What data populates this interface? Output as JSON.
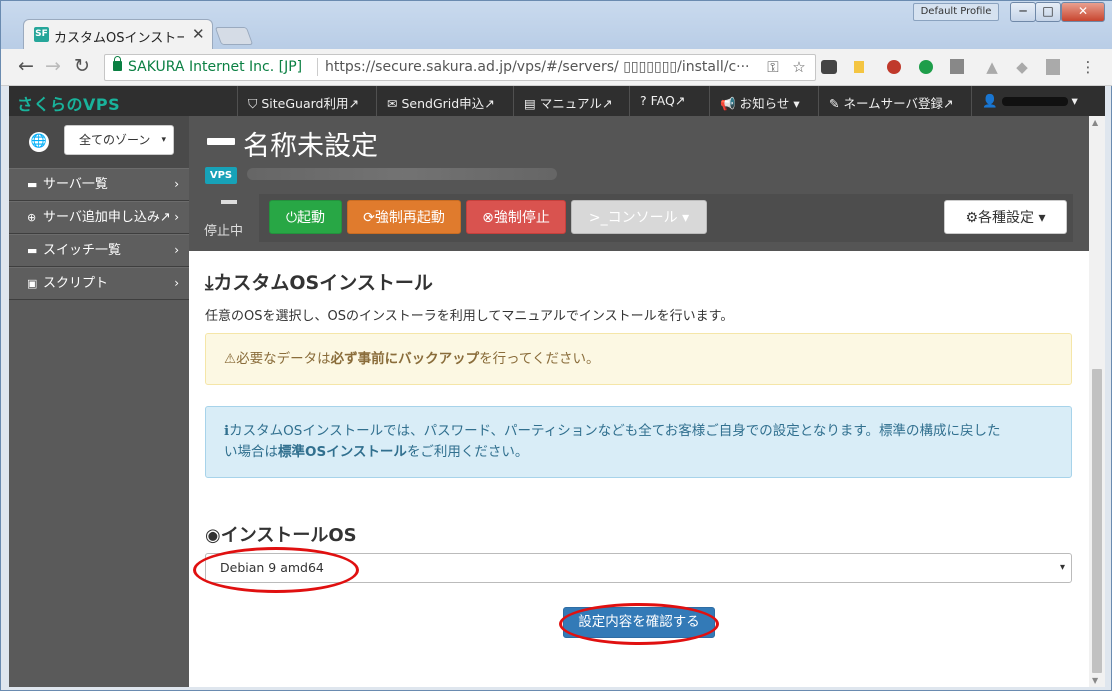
{
  "window": {
    "profile_label": "Default Profile",
    "btn_min": "─",
    "btn_max": "□",
    "btn_close": "✕"
  },
  "tab": {
    "favicon": "SF",
    "title": "カスタムOSインストー/",
    "close": "✕"
  },
  "toolbar": {
    "back": "←",
    "forward": "→",
    "reload": "↻",
    "security_name": "SAKURA Internet Inc. [JP]",
    "url": "https://secure.sakura.ad.jp/vps/#/servers/ ▯▯▯▯▯▯▯/install/c···",
    "key": "⚿",
    "star": "☆",
    "menu": "⋮"
  },
  "topnav": {
    "brand": "さくらのVPS",
    "links": [
      {
        "icon": "⛉",
        "label": "SiteGuard利用",
        "ext": "↗"
      },
      {
        "icon": "✉",
        "label": "SendGrid申込",
        "ext": "↗"
      },
      {
        "icon": "▤",
        "label": "マニュアル",
        "ext": "↗"
      },
      {
        "icon": "?",
        "label": "FAQ",
        "ext": "↗"
      },
      {
        "icon": "📢",
        "label": "お知らせ",
        "ext": "▾"
      },
      {
        "icon": "✎",
        "label": "ネームサーバ登録",
        "ext": "↗"
      },
      {
        "icon": "👤",
        "label": "",
        "ext": "▾"
      }
    ]
  },
  "sidebar": {
    "globe": "🌐",
    "zone_select": "全てのゾーン",
    "zone_caret": "▾",
    "items": [
      {
        "icon": "▬",
        "label": "サーバ一覧",
        "chev": "›"
      },
      {
        "icon": "⊕",
        "label": "サーバ追加申し込み↗",
        "chev": "›"
      },
      {
        "icon": "▬",
        "label": "スイッチ一覧",
        "chev": "›"
      },
      {
        "icon": "▣",
        "label": "スクリプト",
        "chev": "›"
      }
    ]
  },
  "server": {
    "name": "名称未設定",
    "badge": "VPS",
    "status": "停止中",
    "buttons": {
      "start": "⏻起動",
      "restart": "⟳強制再起動",
      "stop": "⊗強制停止",
      "console": ">_コンソール ▾",
      "settings": "⚙各種設定 ▾"
    }
  },
  "main": {
    "title_icon": "⤓",
    "title": "カスタムOSインストール",
    "description": "任意のOSを選択し、OSのインストーラを利用してマニュアルでインストールを行います。",
    "warning": {
      "icon": "⚠",
      "prefix": "必要なデータは",
      "bold": "必ず事前にバックアップ",
      "suffix": "を行ってください。"
    },
    "info": {
      "icon": "ℹ",
      "line1": "カスタムOSインストールでは、パスワード、パーティションなども全てお客様ご自身での設定となります。標準の構成に戻した",
      "line2_prefix": "い場合は",
      "line2_bold": "標準OSインストール",
      "line2_suffix": "をご利用ください。"
    },
    "os_section_icon": "◉",
    "os_section_title": "インストールOS",
    "os_selected": "Debian 9 amd64",
    "os_caret": "▾",
    "confirm_button": "設定内容を確認する"
  },
  "colors": {
    "accent": "#337ab7",
    "start": "#28a745",
    "restart": "#e07b2d",
    "stop": "#d9534f",
    "highlight": "#e01010"
  }
}
